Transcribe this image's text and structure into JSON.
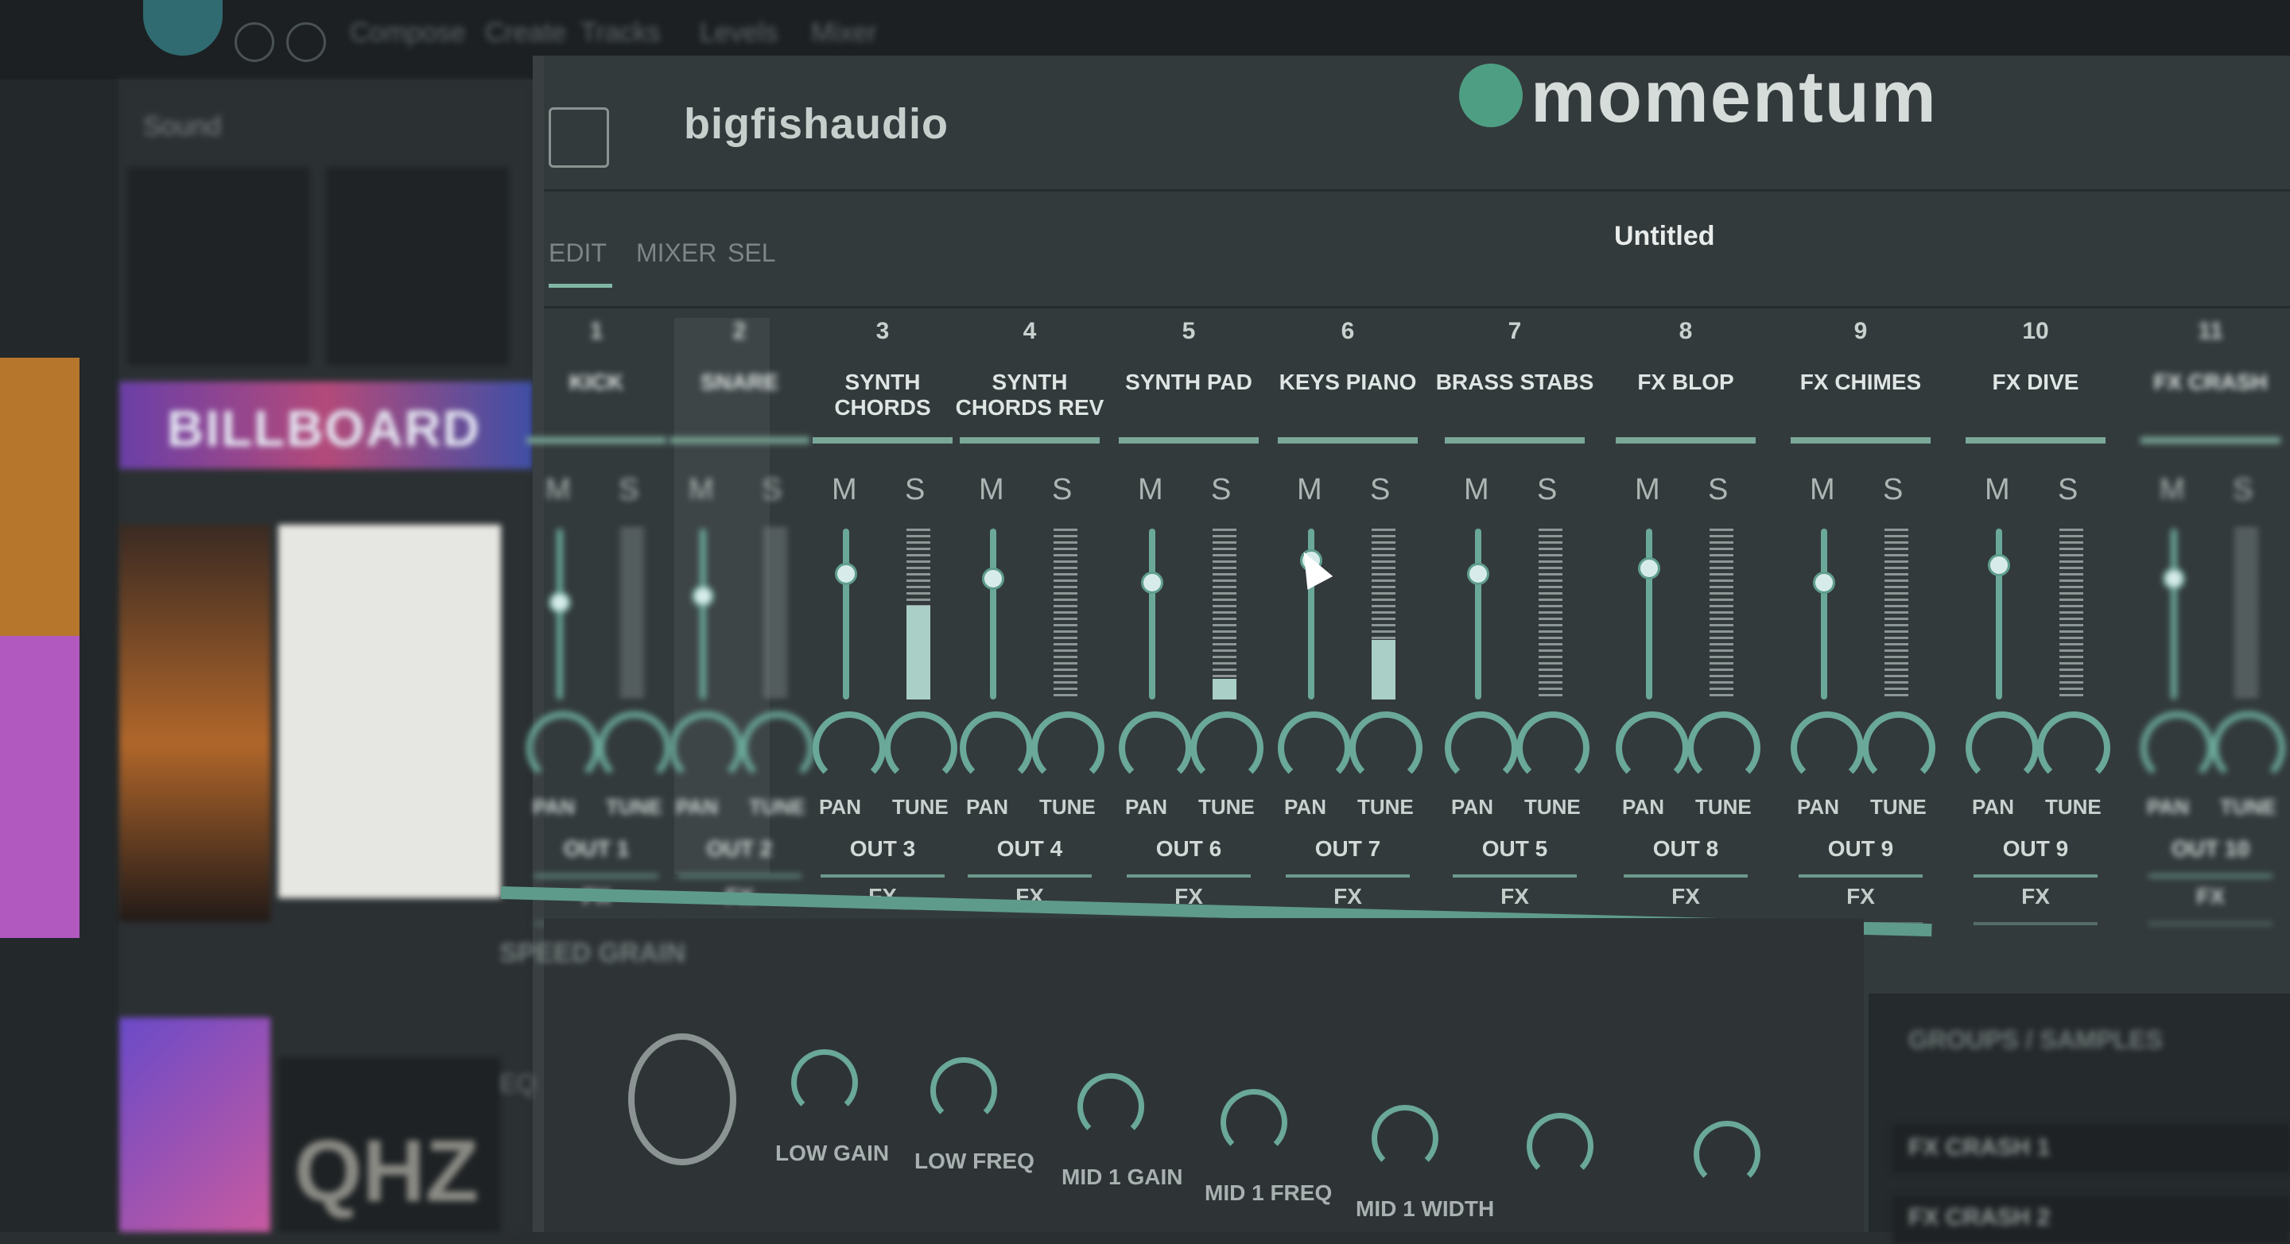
{
  "menu": [
    "Compose",
    "Create",
    "Tracks",
    "Levels",
    "Mixer"
  ],
  "browser": {
    "title": "Sound",
    "banner": "BILLBOARD",
    "art_text": "QHZ"
  },
  "plugin": {
    "vendor": "bigfishaudio",
    "product": "momentum",
    "preset_name": "Untitled",
    "tabs": [
      "EDIT",
      "MIXER",
      "SEL"
    ]
  },
  "channels": [
    {
      "num": "1",
      "name": "KICK",
      "pan": "PAN",
      "tune": "TUNE",
      "out": "OUT 1",
      "fx": "FX",
      "level": 0.58,
      "meter": 0.0
    },
    {
      "num": "2",
      "name": "SNARE",
      "pan": "PAN",
      "tune": "TUNE",
      "out": "OUT 2",
      "fx": "FX",
      "level": 0.62,
      "meter": 0.0
    },
    {
      "num": "3",
      "name": "SYNTH CHORDS",
      "pan": "PAN",
      "tune": "TUNE",
      "out": "OUT 3",
      "fx": "FX",
      "level": 0.75,
      "meter": 0.55
    },
    {
      "num": "4",
      "name": "SYNTH CHORDS REV",
      "pan": "PAN",
      "tune": "TUNE",
      "out": "OUT 4",
      "fx": "FX",
      "level": 0.72,
      "meter": 0.0
    },
    {
      "num": "5",
      "name": "SYNTH PAD",
      "pan": "PAN",
      "tune": "TUNE",
      "out": "OUT 6",
      "fx": "FX",
      "level": 0.7,
      "meter": 0.12
    },
    {
      "num": "6",
      "name": "KEYS PIANO",
      "pan": "PAN",
      "tune": "TUNE",
      "out": "OUT 7",
      "fx": "FX",
      "level": 0.83,
      "meter": 0.35
    },
    {
      "num": "7",
      "name": "BRASS STABS",
      "pan": "PAN",
      "tune": "TUNE",
      "out": "OUT 5",
      "fx": "FX",
      "level": 0.75,
      "meter": 0.0
    },
    {
      "num": "8",
      "name": "FX BLOP",
      "pan": "PAN",
      "tune": "TUNE",
      "out": "OUT 8",
      "fx": "FX",
      "level": 0.78,
      "meter": 0.0
    },
    {
      "num": "9",
      "name": "FX CHIMES",
      "pan": "PAN",
      "tune": "TUNE",
      "out": "OUT 9",
      "fx": "FX",
      "level": 0.7,
      "meter": 0.0
    },
    {
      "num": "10",
      "name": "FX DIVE",
      "pan": "PAN",
      "tune": "TUNE",
      "out": "OUT 9",
      "fx": "FX",
      "level": 0.8,
      "meter": 0.0
    },
    {
      "num": "11",
      "name": "FX CRASH",
      "pan": "PAN",
      "tune": "TUNE",
      "out": "OUT 10",
      "fx": "FX",
      "level": 0.72,
      "meter": 0.0
    }
  ],
  "lower": {
    "title": "SPEED GRAIN",
    "side_label": "EQ",
    "knobs": [
      "LOW GAIN",
      "LOW FREQ",
      "MID 1 GAIN",
      "MID 1 FREQ",
      "MID 1 WIDTH",
      "",
      ""
    ]
  },
  "right_panel": {
    "title": "GROUPS / SAMPLES",
    "row1": "FX CRASH 1",
    "row2": "FX CRASH 2"
  },
  "colors": {
    "accent": "#6aa89a",
    "background": "#333a3c"
  }
}
